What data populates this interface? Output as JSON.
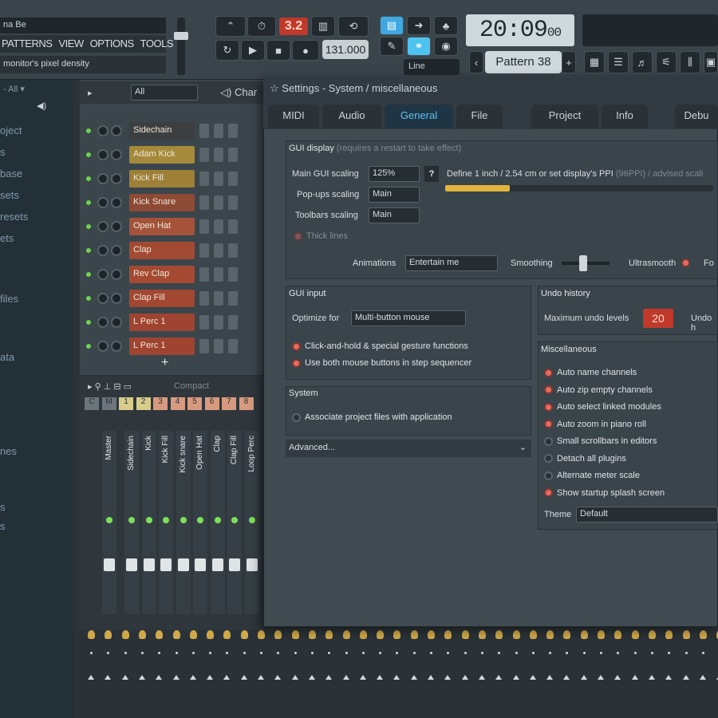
{
  "app": {
    "song_title": "na Be",
    "menu": [
      "PATTERNS",
      "VIEW",
      "OPTIONS",
      "TOOLS",
      "?"
    ],
    "hint": "monitor's pixel density",
    "tempo_led": "3.2",
    "tempo": "131.000",
    "time_main": "20:09",
    "time_sub": "00",
    "pattern": "Pattern 38",
    "snap": "Line"
  },
  "browser": {
    "filter": "All",
    "items": [
      "oject",
      "s",
      "base",
      "sets",
      "resets",
      "ets",
      "files",
      "ata",
      "nes",
      "s",
      "s"
    ]
  },
  "rack": {
    "filter": "All",
    "title": "Char",
    "channels": [
      {
        "name": "Sidechain",
        "color": "#3b3f40"
      },
      {
        "name": "Adam Kick",
        "color": "#a48a3a"
      },
      {
        "name": "Kick Fill",
        "color": "#9d7f36"
      },
      {
        "name": "Kick Snare",
        "color": "#8d4a35"
      },
      {
        "name": "Open Hat",
        "color": "#a4533a"
      },
      {
        "name": "Clap",
        "color": "#a34a33"
      },
      {
        "name": "Rev Clap",
        "color": "#a44a33"
      },
      {
        "name": "Clap Fill",
        "color": "#a24731"
      },
      {
        "name": "L Perc 1",
        "color": "#9e4430"
      },
      {
        "name": "L Perc 1",
        "color": "#9e4430"
      }
    ],
    "add": "+"
  },
  "mixer": {
    "mode": "Compact",
    "header": [
      "C",
      "M",
      "1",
      "2",
      "3",
      "4",
      "5",
      "6",
      "7",
      "8"
    ],
    "strips": [
      "Master",
      "Sidechain",
      "Kick",
      "Kick Fill",
      "Kick snare",
      "Open Hat",
      "Clap",
      "Clap Fill",
      "Loop Perc"
    ]
  },
  "settings": {
    "title": "Settings - System / miscellaneous",
    "tabs": [
      "MIDI",
      "Audio",
      "General",
      "File",
      "Project",
      "Info",
      "Debu"
    ],
    "active_tab": "General",
    "gui_display": {
      "title": "GUI display",
      "note": "(requires a restart to take effect)",
      "main_label": "Main GUI scaling",
      "main_value": "125%",
      "help": "?",
      "popups_label": "Pop-ups scaling",
      "popups_value": "Main",
      "toolbars_label": "Toolbars scaling",
      "toolbars_value": "Main",
      "define_text": "Define 1 inch / 2.54 cm or set display's PPI",
      "define_dim": "(96PPI) / advised scali",
      "thick_lines": "Thick lines",
      "animations_label": "Animations",
      "animations_value": "Entertain me",
      "smoothing_label": "Smoothing",
      "ultrasmooth": "Ultrasmooth",
      "fo": "Fo",
      "ppi_progress": 0.24
    },
    "gui_input": {
      "title": "GUI input",
      "optimize_label": "Optimize for",
      "optimize_value": "Multi-button mouse",
      "options": [
        {
          "label": "Click-and-hold & special gesture functions",
          "on": true
        },
        {
          "label": "Use both mouse buttons in step sequencer",
          "on": true
        }
      ]
    },
    "system": {
      "title": "System",
      "options": [
        {
          "label": "Associate project files with application",
          "on": false
        }
      ]
    },
    "advanced": "Advanced...",
    "undo": {
      "title": "Undo history",
      "max_label": "Maximum undo levels",
      "max_value": "20",
      "undo_cut": "Undo h"
    },
    "misc": {
      "title": "Miscellaneous",
      "options": [
        {
          "label": "Auto name channels",
          "on": true
        },
        {
          "label": "Auto zip empty channels",
          "on": true
        },
        {
          "label": "Auto select linked modules",
          "on": true
        },
        {
          "label": "Auto zoom in piano roll",
          "on": true
        },
        {
          "label": "Small scrollbars in editors",
          "on": false
        },
        {
          "label": "Detach all plugins",
          "on": false
        },
        {
          "label": "Alternate meter scale",
          "on": false
        },
        {
          "label": "Show startup splash screen",
          "on": true
        }
      ],
      "theme_label": "Theme",
      "theme_value": "Default"
    }
  }
}
